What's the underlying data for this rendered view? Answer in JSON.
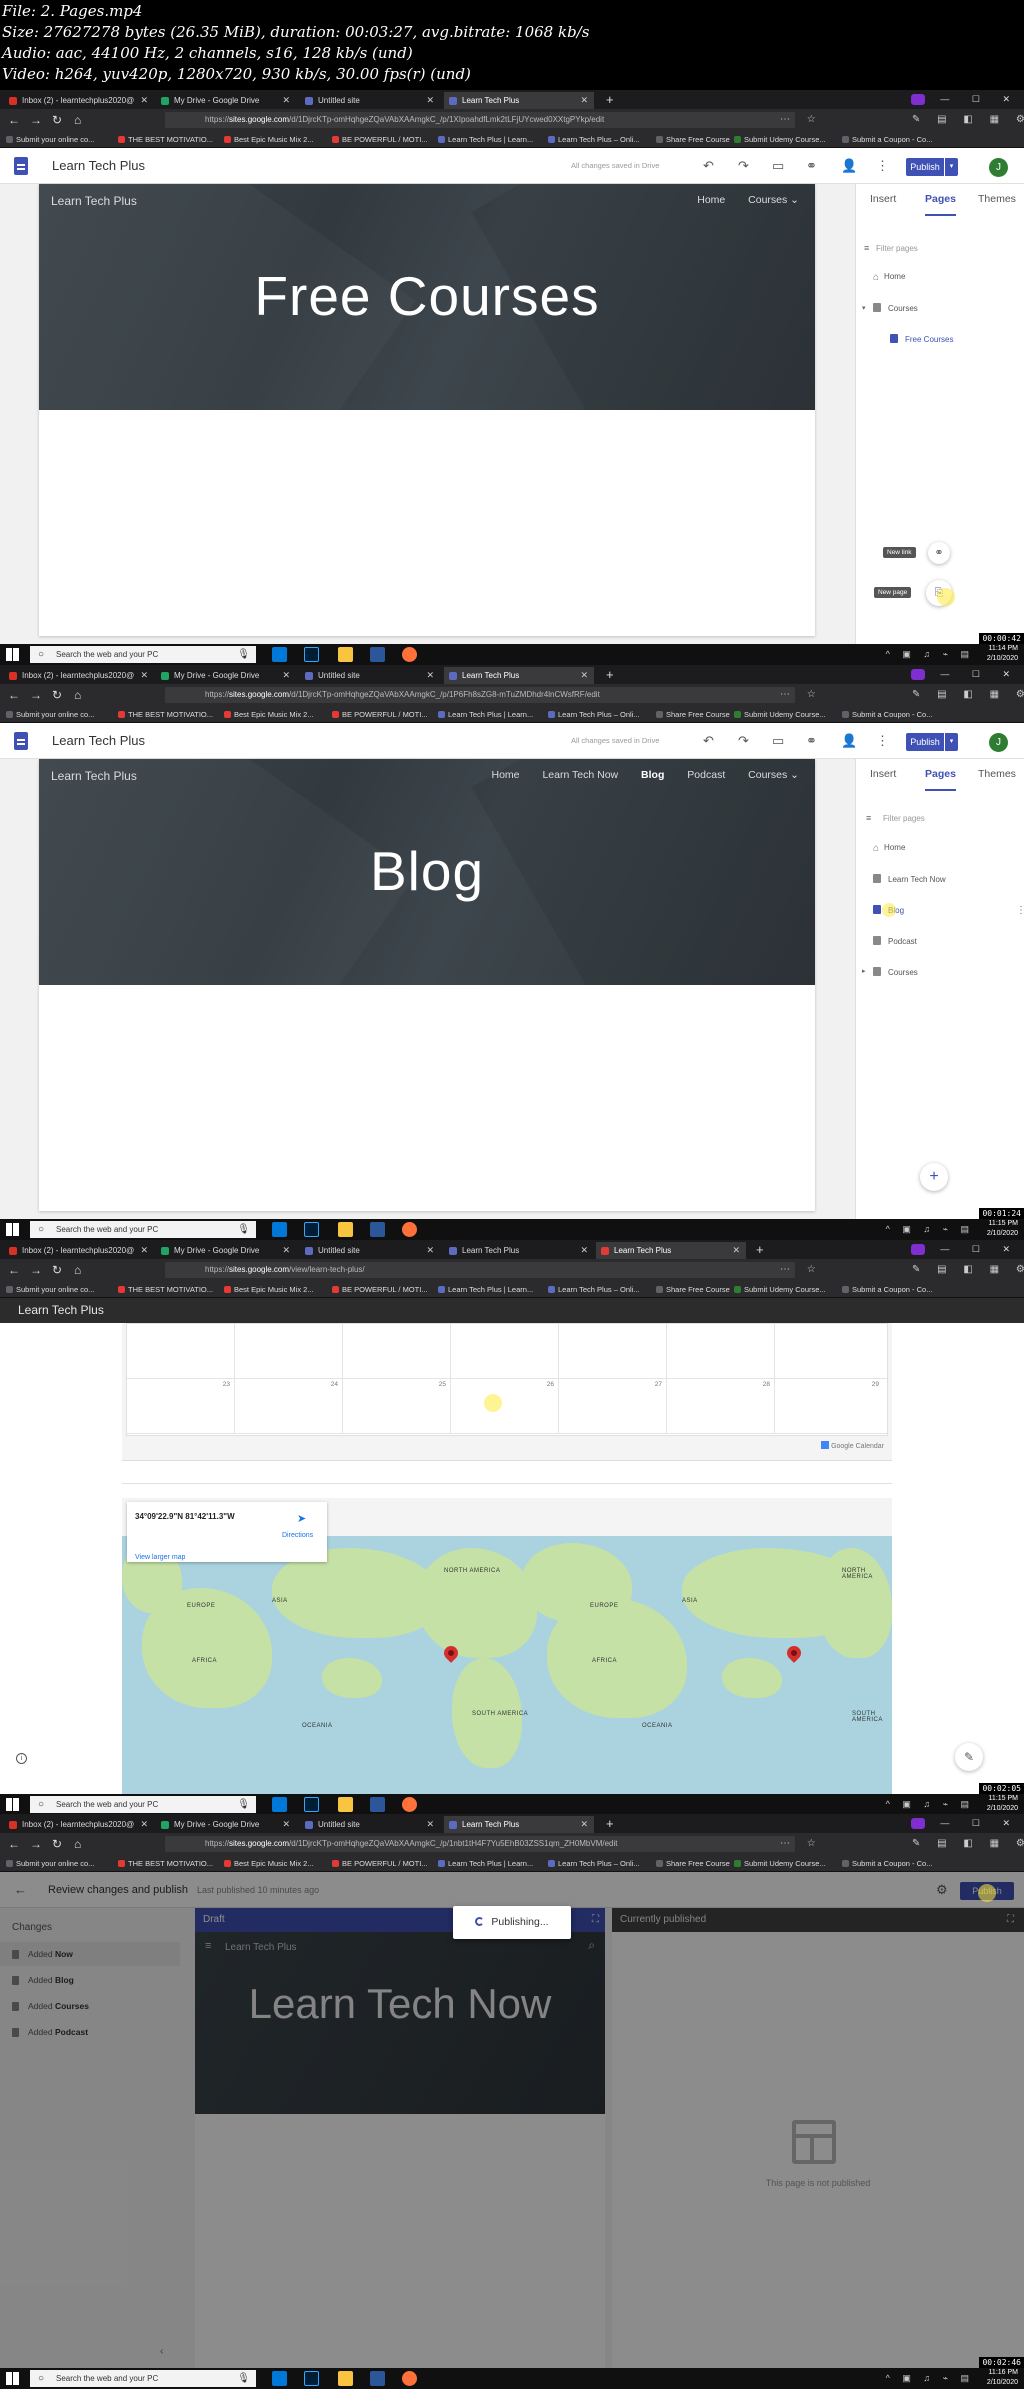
{
  "meta": {
    "lines": [
      "File: 2. Pages.mp4",
      "Size: 27627278 bytes (26.35 MiB), duration: 00:03:27, avg.bitrate: 1068 kb/s",
      "Audio: aac, 44100 Hz, 2 channels, s16, 128 kb/s (und)",
      "Video: h264, yuv420p, 1280x720, 930 kb/s, 30.00 fps(r) (und)"
    ]
  },
  "colors": {
    "accent": "#3f51b5",
    "avatar": "#2e7d32",
    "hero": "#363f45"
  },
  "bookmarks": [
    "Submit your online co...",
    "THE BEST MOTIVATIO...",
    "Best Epic Music Mix 2...",
    "BE POWERFUL / MOTI...",
    "Learn Tech Plus | Learn...",
    "Learn Tech Plus – Onli...",
    "Share Free Course",
    "Submit Udemy Course...",
    "Submit a Coupon - Co..."
  ],
  "taskbar": {
    "search_placeholder": "Search the web and your PC"
  },
  "frame1": {
    "tabs": [
      "Inbox (2) - learntechplus2020@",
      "My Drive - Google Drive",
      "Untitled site",
      "Learn Tech Plus"
    ],
    "url_pre": "https://",
    "url_domain": "sites.google.com",
    "url_post": "/d/1DjrcKTp-omHqhgeZQaVAbXAAmgkC_/p/1XIpoahdfLmk2tLFjUYcwed0XXtgPYkp/edit",
    "site_name": "Learn Tech Plus",
    "saved": "All changes saved in Drive",
    "publish": "Publish",
    "avatar": "J",
    "hero": {
      "site": "Learn Tech Plus",
      "nav": [
        "Home",
        "Courses ⌄"
      ],
      "title": "Free Courses"
    },
    "panel_tabs": [
      "Insert",
      "Pages",
      "Themes"
    ],
    "filter": "Filter pages",
    "pages": [
      "Home",
      "Courses",
      "Free Courses"
    ],
    "fab_labels": [
      "New link",
      "New page"
    ],
    "clock": {
      "time": "11:14 PM",
      "date": "2/10/2020"
    },
    "stamp": "00:00:42"
  },
  "frame2": {
    "tabs": [
      "Inbox (2) - learntechplus2020@",
      "My Drive - Google Drive",
      "Untitled site",
      "Learn Tech Plus"
    ],
    "url_pre": "https://",
    "url_domain": "sites.google.com",
    "url_post": "/d/1DjrcKTp-omHqhgeZQaVAbXAAmgkC_/p/1P6Fh8sZG8-mTuZMDhdr4lnCWsfRF/edit",
    "site_name": "Learn Tech Plus",
    "saved": "All changes saved in Drive",
    "publish": "Publish",
    "avatar": "J",
    "hero": {
      "site": "Learn Tech Plus",
      "nav": [
        "Home",
        "Learn Tech Now",
        "Blog",
        "Podcast",
        "Courses ⌄"
      ],
      "title": "Blog"
    },
    "panel_tabs": [
      "Insert",
      "Pages",
      "Themes"
    ],
    "filter": "Filter pages",
    "pages": [
      "Home",
      "Learn Tech Now",
      "Blog",
      "Podcast",
      "Courses"
    ],
    "clock": {
      "time": "11:15 PM",
      "date": "2/10/2020"
    },
    "stamp": "00:01:24"
  },
  "frame3": {
    "tabs": [
      "Inbox (2) - learntechplus2020@",
      "My Drive - Google Drive",
      "Untitled site",
      "Learn Tech Plus",
      "Learn Tech Plus"
    ],
    "url_pre": "https://",
    "url_domain": "sites.google.com",
    "url_post": "/view/learn-tech-plus/",
    "header_title": "Learn Tech Plus",
    "cal_days": [
      "23",
      "24",
      "25",
      "26",
      "27",
      "28",
      "29"
    ],
    "gcal": "Google Calendar",
    "map": {
      "coords": "34°09'22.9\"N 81°42'11.3\"W",
      "directions": "Directions",
      "larger": "View larger map",
      "labels": [
        "ASIA",
        "EUROPE",
        "AFRICA",
        "SOUTH AMERICA",
        "OCEANIA",
        "NORTH AMERICA",
        "ASIA",
        "EUROPE",
        "AFRICA",
        "SOUTH AMERICA",
        "OCEANIA",
        "NORTH AMERICA"
      ]
    },
    "clock": {
      "time": "11:15 PM",
      "date": "2/10/2020"
    },
    "stamp": "00:02:05"
  },
  "frame4": {
    "tabs": [
      "Inbox (2) - learntechplus2020@",
      "My Drive - Google Drive",
      "Untitled site",
      "Learn Tech Plus"
    ],
    "url_pre": "https://",
    "url_domain": "sites.google.com",
    "url_post": "/d/1DjrcKTp-omHqhgeZQaVAbXAAmgkC_/p/1nbt1tH4F7Yu5EhB03ZSS1qm_ZH0MbVM/edit",
    "title": "Review changes and publish",
    "last_published": "Last published 10 minutes ago",
    "publish": "Publish",
    "changes_header": "Changes",
    "changes": [
      {
        "pre": "Added ",
        "name": "Now"
      },
      {
        "pre": "Added ",
        "name": "Blog"
      },
      {
        "pre": "Added ",
        "name": "Courses"
      },
      {
        "pre": "Added ",
        "name": "Podcast"
      }
    ],
    "draft_label": "Draft",
    "draft_site": "Learn Tech Plus",
    "draft_title": "Learn Tech Now",
    "current_label": "Currently published",
    "not_published": "This page is not published",
    "publishing": "Publishing...",
    "clock": {
      "time": "11:16 PM",
      "date": "2/10/2020"
    },
    "stamp": "00:02:46"
  }
}
